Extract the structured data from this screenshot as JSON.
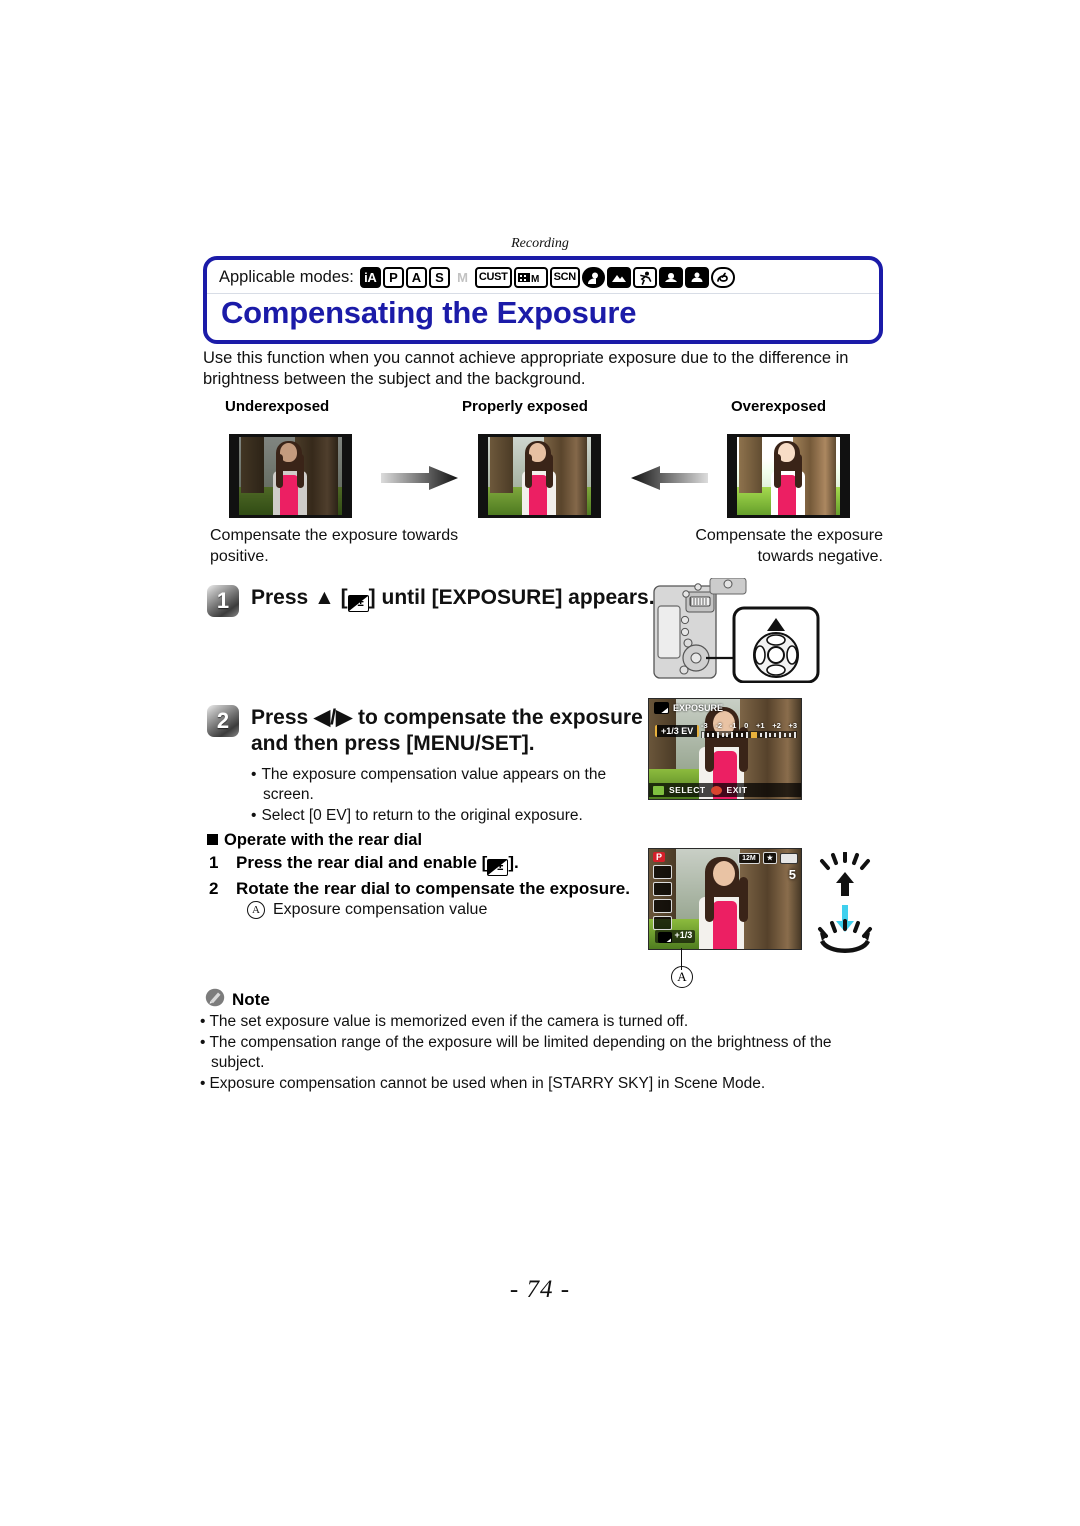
{
  "page": {
    "running_head": "Recording",
    "page_number": "- 74 -"
  },
  "header": {
    "applicable_label": "Applicable modes:",
    "title": "Compensating the Exposure",
    "modes": [
      {
        "name": "intelligent-auto",
        "text": "iA",
        "style": "filled"
      },
      {
        "name": "program-ae",
        "text": "P",
        "style": "normal"
      },
      {
        "name": "aperture-priority",
        "text": "A",
        "style": "normal"
      },
      {
        "name": "shutter-priority",
        "text": "S",
        "style": "normal"
      },
      {
        "name": "manual-exposure",
        "text": "M",
        "style": "dim"
      },
      {
        "name": "custom",
        "text": "CUST",
        "style": "wide"
      },
      {
        "name": "creative-motion-picture",
        "text": "M",
        "style": "movie"
      },
      {
        "name": "scene-mode",
        "text": "SCN",
        "style": "wide"
      },
      {
        "name": "portrait-scene",
        "text": "",
        "style": "glyph-portrait"
      },
      {
        "name": "scenery-scene",
        "text": "",
        "style": "glyph-scenery"
      },
      {
        "name": "sports-scene",
        "text": "",
        "style": "glyph-sports"
      },
      {
        "name": "close-up-scene",
        "text": "",
        "style": "glyph-closeup"
      },
      {
        "name": "night-portrait-scene",
        "text": "",
        "style": "glyph-night"
      },
      {
        "name": "creative-control",
        "text": "",
        "style": "glyph-creative"
      }
    ]
  },
  "intro": "Use this function when you cannot achieve appropriate exposure due to the difference in brightness between the subject and the background.",
  "comparison": {
    "labels": [
      "Underexposed",
      "Properly exposed",
      "Overexposed"
    ],
    "caption_left": "Compensate the exposure towards positive.",
    "caption_right": "Compensate the exposure towards negative."
  },
  "steps": [
    {
      "number": "1",
      "heading_before": "Press ▲ [",
      "heading_after": "] until [EXPOSURE] appears.",
      "bullets": []
    },
    {
      "number": "2",
      "heading": "Press ◀/▶ to compensate the exposure and then press [MENU/SET].",
      "bullets": [
        "The exposure compensation value appears on the screen.",
        "Select [0 EV] to return to the original exposure."
      ]
    }
  ],
  "rear_dial": {
    "heading": "Operate with the rear dial",
    "items": [
      {
        "number": "1",
        "text_before": "Press the rear dial and enable [",
        "text_after": "]."
      },
      {
        "number": "2",
        "text_before": "Rotate the rear dial to compensate the exposure.",
        "text_after": ""
      }
    ],
    "annotation_marker": "A",
    "annotation_text": "Exposure compensation value"
  },
  "exposure_screen": {
    "title": "EXPOSURE",
    "ev_value": "+1/3 EV",
    "scale_ticks": [
      "-3",
      "-2",
      "-1",
      "0",
      "+1",
      "+2",
      "+3"
    ],
    "select_label": "SELECT",
    "exit_label": "EXIT"
  },
  "rec_screen": {
    "mode_badge": "P",
    "picture_size": "12M",
    "quality": "★",
    "remaining": "5",
    "ev_value": "+1/3"
  },
  "note": {
    "heading": "Note",
    "bullets": [
      "The set exposure value is memorized even if the camera is turned off.",
      "The compensation range of the exposure will be limited depending on the brightness of the subject.",
      "Exposure compensation cannot be used when in [STARRY SKY] in Scene Mode."
    ]
  },
  "colors": {
    "title_blue": "#1b1ba8",
    "accent_cyan": "#3fd0ee",
    "mode_red": "#d3202a"
  }
}
